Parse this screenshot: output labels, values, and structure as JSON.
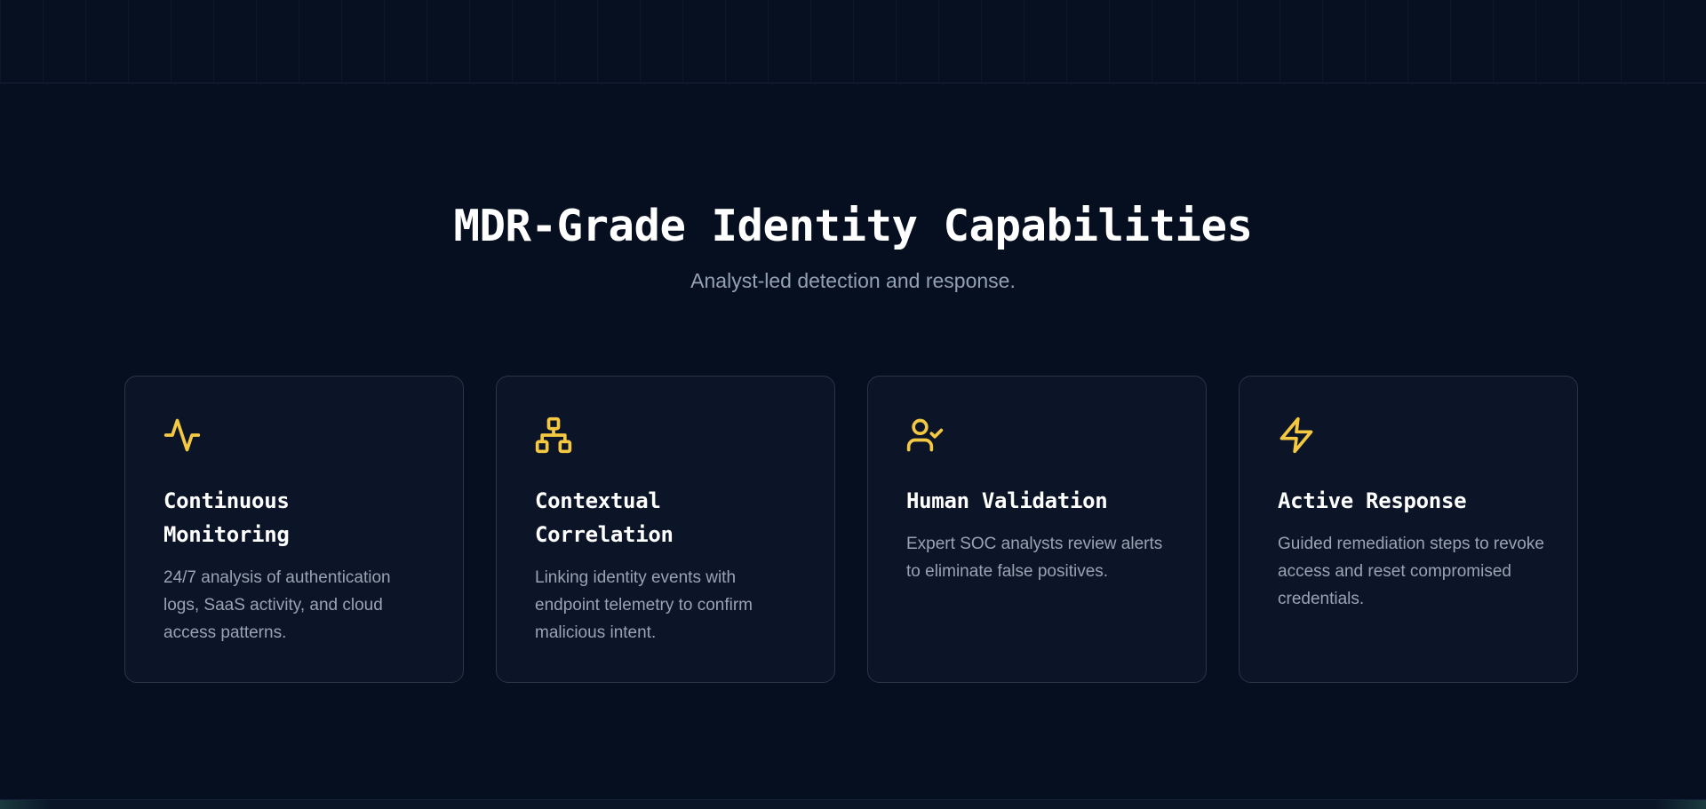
{
  "section": {
    "heading": "MDR-Grade Identity Capabilities",
    "subheading": "Analyst-led detection and response."
  },
  "cards": [
    {
      "icon": "activity-icon",
      "title_line1": "Continuous",
      "title_line2": "Monitoring",
      "description": "24/7 analysis of authentication logs, SaaS activity, and cloud access patterns."
    },
    {
      "icon": "network-icon",
      "title_line1": "Contextual",
      "title_line2": "Correlation",
      "description": "Linking identity events with endpoint telemetry to confirm malicious intent."
    },
    {
      "icon": "user-check-icon",
      "title_line1": "Human Validation",
      "description": "Expert SOC analysts review alerts to eliminate false positives."
    },
    {
      "icon": "lightning-icon",
      "title_line1": "Active Response",
      "description": "Guided remediation steps to revoke access and reset compromised credentials."
    }
  ],
  "colors": {
    "background": "#050f1f",
    "card_background": "#0b1527",
    "card_border": "#2a3549",
    "accent": "#f5c842",
    "heading": "#ffffff",
    "muted_text": "#9aa3b3"
  }
}
